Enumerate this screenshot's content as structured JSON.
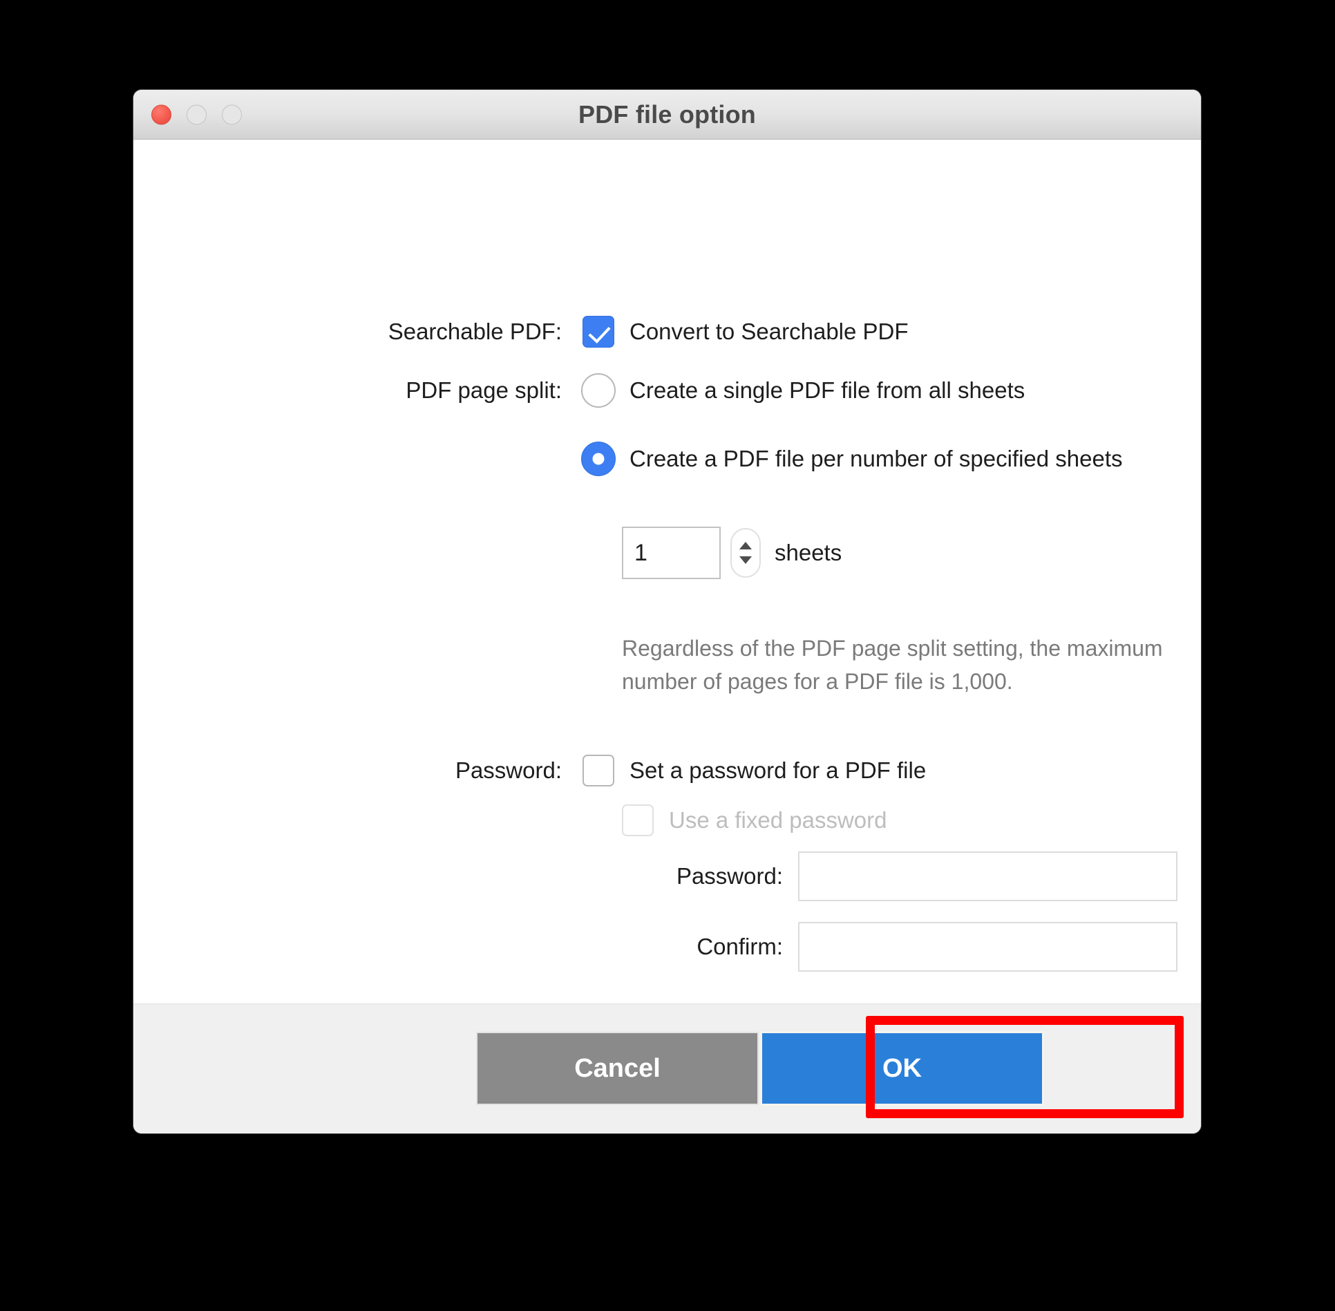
{
  "window": {
    "title": "PDF file option",
    "traffic_lights": [
      "close-button",
      "minimize-button",
      "maximize-button"
    ],
    "accent_blue": "#3d7ff2",
    "ok_button_blue": "#2a80d8",
    "cancel_button_gray": "#8a8a8a",
    "highlight_red": "#fe0000"
  },
  "form": {
    "searchable": {
      "label": "Searchable PDF:",
      "checkbox_label": "Convert to Searchable PDF",
      "checked": true
    },
    "page_split": {
      "label": "PDF page split:",
      "option_single": "Create a single PDF file from all sheets",
      "option_per_sheets": "Create a PDF file per number of specified sheets",
      "selected": "per_sheets",
      "sheets_value": "1",
      "sheets_unit": "sheets",
      "note": "Regardless of the PDF page split setting, the maximum number of pages for a PDF file is 1,000."
    },
    "password": {
      "label": "Password:",
      "set_password_label": "Set a password for a PDF file",
      "set_password_checked": false,
      "fixed_password_label": "Use a fixed password",
      "fixed_password_checked": false,
      "fixed_password_disabled": true,
      "password_field_label": "Password:",
      "password_field_value": "",
      "confirm_field_label": "Confirm:",
      "confirm_field_value": ""
    }
  },
  "footer": {
    "cancel_label": "Cancel",
    "ok_label": "OK"
  }
}
